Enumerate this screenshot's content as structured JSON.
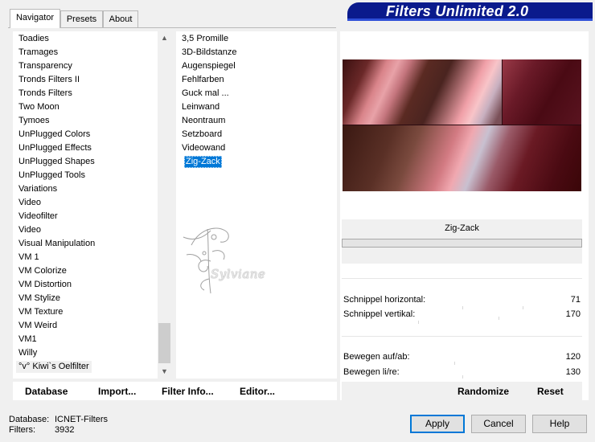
{
  "tabs": [
    {
      "label": "Navigator",
      "active": true
    },
    {
      "label": "Presets",
      "active": false
    },
    {
      "label": "About",
      "active": false
    }
  ],
  "banner": {
    "title": "Filters Unlimited 2.0",
    "color": "#0a1a8c"
  },
  "categories": [
    "Toadies",
    "Tramages",
    "Transparency",
    "Tronds Filters II",
    "Tronds Filters",
    "Two Moon",
    "Tymoes",
    "UnPlugged Colors",
    "UnPlugged Effects",
    "UnPlugged Shapes",
    "UnPlugged Tools",
    "Variations",
    "Video",
    "Videofilter",
    "Video",
    "Visual Manipulation",
    "VM 1",
    "VM Colorize",
    "VM Distortion",
    "VM Stylize",
    "VM Texture",
    "VM Weird",
    "VM1",
    "Willy",
    "°v° Kiwi`s Oelfilter"
  ],
  "current_category": "°v° Kiwi`s Oelfilter",
  "filters": [
    "3,5 Promille",
    "3D-Bildstanze",
    "Augenspiegel",
    "Fehlfarben",
    "Guck mal ...",
    "Leinwand",
    "Neontraum",
    "Setzboard",
    "Videowand",
    "Zig-Zack"
  ],
  "selected_filter": "Zig-Zack",
  "toolbar": {
    "database": "Database",
    "import": "Import...",
    "filter_info": "Filter Info...",
    "editor": "Editor..."
  },
  "watermark": {
    "text": "Sylviane"
  },
  "preview": {
    "filter_name": "Zig-Zack"
  },
  "params": [
    {
      "label": "Schnippel horizontal:",
      "value": "71"
    },
    {
      "label": "Schnippel vertikal:",
      "value": "170"
    },
    {
      "label": "Bewegen auf/ab:",
      "value": "120"
    },
    {
      "label": "Bewegen li/re:",
      "value": "130"
    }
  ],
  "preview_buttons": {
    "randomize": "Randomize",
    "reset": "Reset"
  },
  "status": {
    "database_label": "Database:",
    "database_value": "ICNET-Filters",
    "filters_label": "Filters:",
    "filters_value": "3932"
  },
  "buttons": {
    "apply": "Apply",
    "cancel": "Cancel",
    "help": "Help"
  },
  "colors": {
    "selection": "#0078d7",
    "window_bg": "#f0f0f0"
  }
}
